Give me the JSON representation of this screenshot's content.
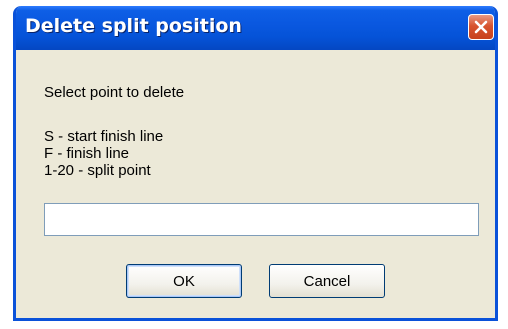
{
  "window": {
    "title": "Delete split position"
  },
  "dialog": {
    "prompt": "Select point to delete",
    "legend": [
      "S - start finish line",
      "F - finish line",
      "1-20 - split point"
    ],
    "input_value": ""
  },
  "buttons": {
    "ok_label": "OK",
    "cancel_label": "Cancel"
  },
  "icons": {
    "close": "close-icon"
  },
  "colors": {
    "titlebar": "#0553d8",
    "window_bg": "#ece9d8",
    "close_button": "#d8542f",
    "input_border": "#7f9db9"
  }
}
